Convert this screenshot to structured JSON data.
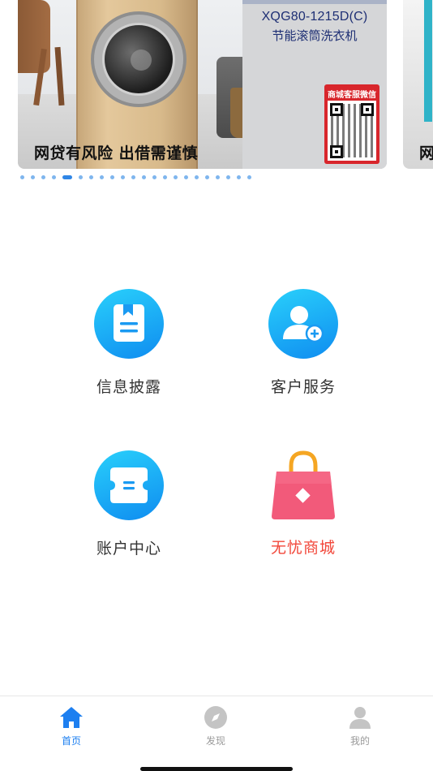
{
  "banner": {
    "model": "XQG80-1215D(C)",
    "product_name": "节能滚筒洗衣机",
    "qr_label": "商城客服微信",
    "warning": "网贷有风险 出借需谨慎",
    "next_warning": "网",
    "dots_total": 22,
    "dots_active_index": 4
  },
  "menu": {
    "items": [
      {
        "label": "信息披露",
        "icon": "document-bookmark-icon"
      },
      {
        "label": "客户服务",
        "icon": "user-add-icon"
      },
      {
        "label": "账户中心",
        "icon": "ticket-icon"
      },
      {
        "label": "无忧商城",
        "icon": "shopping-bag-icon"
      }
    ]
  },
  "tabbar": {
    "tabs": [
      {
        "label": "首页",
        "icon": "home-icon",
        "active": true
      },
      {
        "label": "发现",
        "icon": "compass-icon",
        "active": false
      },
      {
        "label": "我的",
        "icon": "person-icon",
        "active": false
      }
    ]
  },
  "colors": {
    "accent_blue": "#1d7ff0",
    "icon_gradient_start": "#29d0fb",
    "icon_gradient_end": "#0f8cf0",
    "mall_red": "#f2473a",
    "bag_pink": "#f25a7a",
    "bag_handle": "#f5a623"
  }
}
